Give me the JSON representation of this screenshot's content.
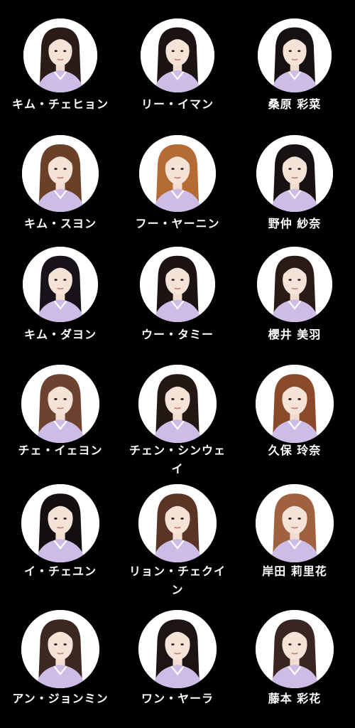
{
  "colors": {
    "background": "#000000",
    "name_text": "#ffffff",
    "avatar_bg": "#ffffff",
    "uniform": "#cdbde6"
  },
  "members": [
    {
      "name": "キム・チェヒョン",
      "hair": "#2a1c16"
    },
    {
      "name": "リー・イマン",
      "hair": "#1b1412"
    },
    {
      "name": "桑原 彩菜",
      "hair": "#161010"
    },
    {
      "name": "キム・スヨン",
      "hair": "#6a4128"
    },
    {
      "name": "フー・ヤーニン",
      "hair": "#b56b34"
    },
    {
      "name": "野仲 紗奈",
      "hair": "#171112"
    },
    {
      "name": "キム・ダヨン",
      "hair": "#18121a"
    },
    {
      "name": "ウー・タミー",
      "hair": "#1c1412"
    },
    {
      "name": "櫻井 美羽",
      "hair": "#2a1b16"
    },
    {
      "name": "チェ・イェヨン",
      "hair": "#6d4230"
    },
    {
      "name": "チェン・シンウェイ",
      "hair": "#241814"
    },
    {
      "name": "久保 玲奈",
      "hair": "#8a4a2a"
    },
    {
      "name": "イ・チェユン",
      "hair": "#141010"
    },
    {
      "name": "リョン・チェクイン",
      "hair": "#5a3424"
    },
    {
      "name": "岸田 莉里花",
      "hair": "#a0613e"
    },
    {
      "name": "アン・ジョンミン",
      "hair": "#3c2820"
    },
    {
      "name": "ワン・ヤーラ",
      "hair": "#1c1514"
    },
    {
      "name": "藤本 彩花",
      "hair": "#3a2520"
    }
  ]
}
